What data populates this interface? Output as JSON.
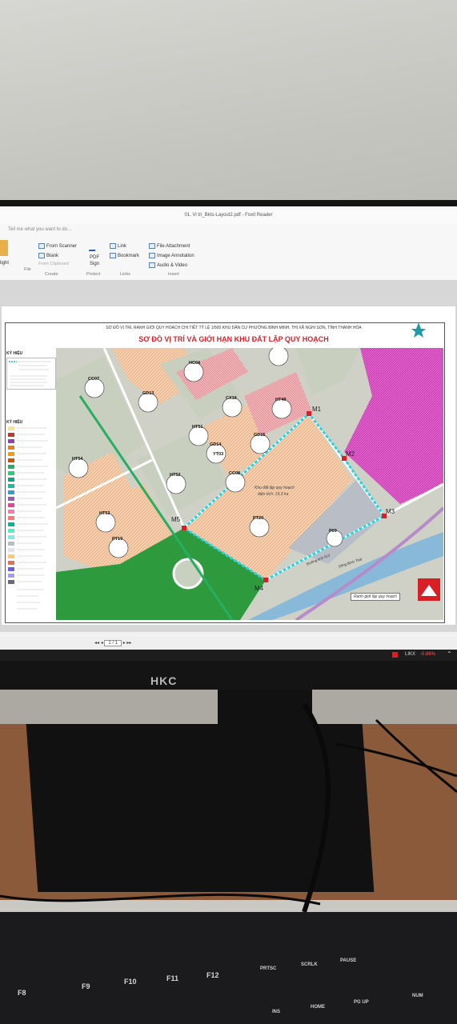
{
  "window": {
    "title": "01. Vi tri_Bkts-Layout2.pdf - Foxit Reader",
    "tell_me": "Tell me what you want to do..."
  },
  "ribbon": {
    "left_label": "light",
    "left_file": "File",
    "create": {
      "from_scanner": "From Scanner",
      "blank": "Blank",
      "from_clipboard": "From Clipboard",
      "group": "Create"
    },
    "protect": {
      "pdf_sign": "PDF\nSign",
      "group": "Protect"
    },
    "links": {
      "link": "Link",
      "bookmark": "Bookmark",
      "group": "Links"
    },
    "insert": {
      "file_attachment": "File Attachment",
      "image_annotation": "Image Annotation",
      "audio_video": "Audio & Video",
      "group": "Insert"
    }
  },
  "map": {
    "header_small": "SƠ ĐỒ VỊ TRÍ, RANH GIỚI QUY HOẠCH CHI TIẾT TỶ LỆ 1/500 KHU DÂN CƯ PHƯỜNG BÌNH MINH, THỊ XÃ NGHI SƠN, TỈNH THANH HÓA",
    "header_title": "SƠ ĐỒ VỊ TRÍ VÀ GIỚI HẠN KHU ĐẤT LẬP QUY HOẠCH",
    "legend_title_1": "KÝ HIỆU",
    "legend_title_2": "KÝ HIỆU",
    "area_label_1": "Khu đất lập quy hoạch",
    "area_label_2": "diện tích: 19,3 ha",
    "boundary_label": "Ranh giới lập quy hoạch",
    "river_label": "Sông Bình Thái",
    "road_label": "Đường tỉnh 513",
    "points": [
      "M1",
      "M2",
      "M3",
      "M4",
      "M5"
    ],
    "lots": [
      "CC07",
      "HC04",
      "GD13",
      "CX16",
      "HT49",
      "HT51",
      "GD14",
      "GD15",
      "HT54",
      "YT03",
      "CC08",
      "HT52",
      "PT20",
      "HT53",
      "P09",
      "PT19"
    ]
  },
  "status": {
    "page": "1 / 1"
  },
  "taskbar": {
    "ticker": "LIKX",
    "change": "-0.86%"
  },
  "monitor": {
    "brand": "HKC"
  },
  "keyboard": {
    "fkeys": [
      "F8",
      "F9",
      "F10",
      "F11",
      "F12"
    ],
    "top_right": [
      "PRTSC",
      "SCRLK",
      "PAUSE"
    ],
    "bottom": [
      "INS",
      "HOME",
      "PG UP",
      "NUM"
    ]
  }
}
